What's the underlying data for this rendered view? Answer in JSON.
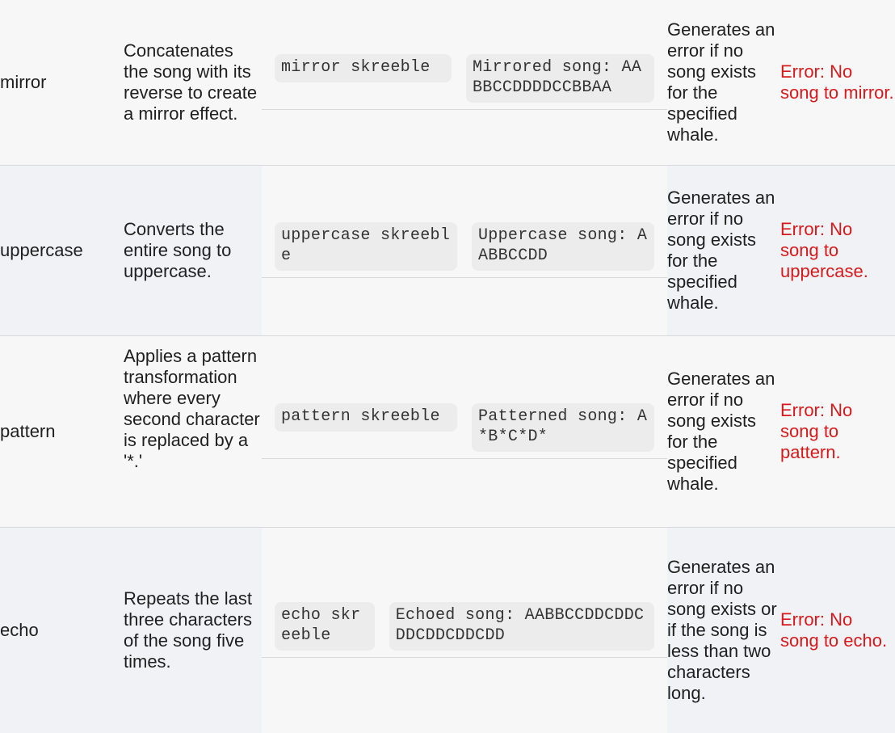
{
  "rows": [
    {
      "name": "mirror",
      "description": "Concatenates the song with its reverse to create a mirror effect.",
      "example_command": "mirror skreeble",
      "example_output": "Mirrored song: AABBCCDDDDCCBBAA",
      "notes": "Generates an error if no song exists for the specified whale.",
      "error": "Error: No song to mirror."
    },
    {
      "name": "uppercase",
      "description": "Converts the entire song to uppercase.",
      "example_command": "uppercase skreeble",
      "example_output": "Uppercase song: AABBCCDD",
      "notes": "Generates an error if no song exists for the specified whale.",
      "error": "Error: No song to uppercase."
    },
    {
      "name": "pattern",
      "description": "Applies a pattern transformation where every second character is replaced by a '*.'",
      "example_command": "pattern skreeble",
      "example_output": "Patterned song: A*B*C*D*",
      "notes": "Generates an error if no song exists for the specified whale.",
      "error": "Error: No song to pattern."
    },
    {
      "name": "echo",
      "description": "Repeats the last three characters of the song five times.",
      "example_command": "echo skreeble",
      "example_output": "Echoed song: AABBCCDDCDDCDDCDDCDDCDD",
      "notes": "Generates an error if no song exists or if the song is less than two characters long.",
      "error": "Error: No song to echo."
    }
  ],
  "colors": {
    "error": "#d7191b",
    "row_odd": "#f7f7f7",
    "row_even": "#f1f2f6",
    "code_bg": "#ececec",
    "divider": "#d9d9d9"
  }
}
